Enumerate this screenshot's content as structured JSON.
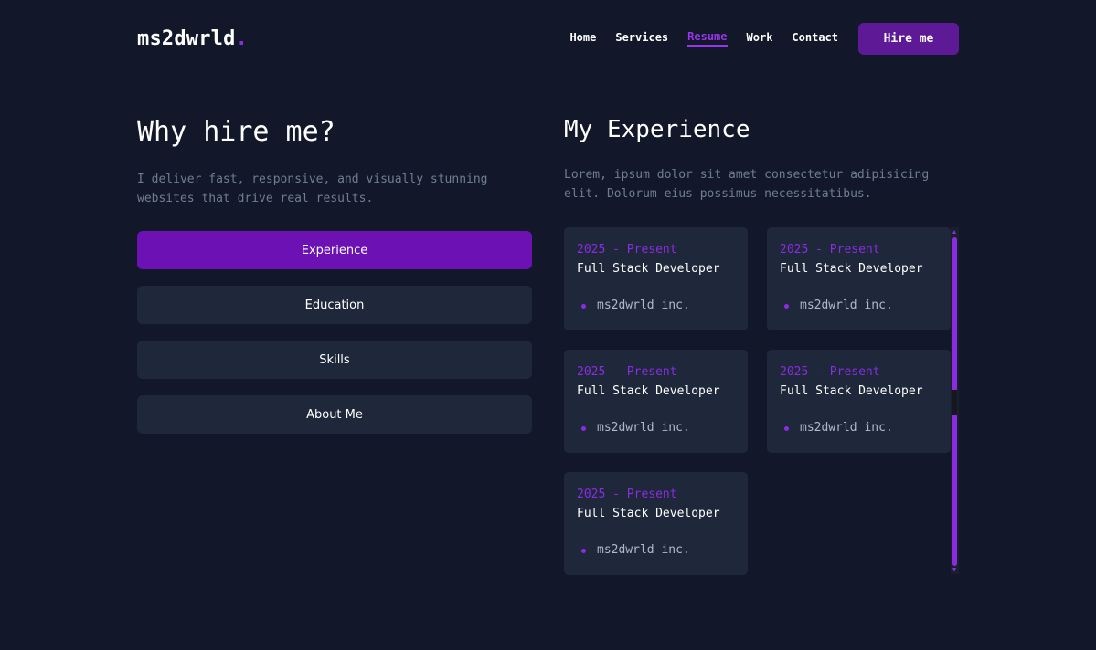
{
  "header": {
    "logo_text": "ms2dwrld",
    "logo_dot": ".",
    "nav": [
      {
        "label": "Home"
      },
      {
        "label": "Services"
      },
      {
        "label": "Resume"
      },
      {
        "label": "Work"
      },
      {
        "label": "Contact"
      }
    ],
    "active_nav": "Resume",
    "hire_label": "Hire me"
  },
  "left": {
    "title": "Why hire me?",
    "description": "I deliver fast, responsive, and visually stunning websites that drive real results.",
    "tabs": [
      {
        "label": "Experience"
      },
      {
        "label": "Education"
      },
      {
        "label": "Skills"
      },
      {
        "label": "About Me"
      }
    ],
    "active_tab": "Experience"
  },
  "right": {
    "title": "My Experience",
    "description": "Lorem, ipsum dolor sit amet consectetur adipisicing elit. Dolorum eius possimus necessitatibus.",
    "cards": [
      {
        "date": "2025 - Present",
        "role": "Full Stack Developer",
        "company": "ms2dwrld inc."
      },
      {
        "date": "2025 - Present",
        "role": "Full Stack Developer",
        "company": "ms2dwrld inc."
      },
      {
        "date": "2025 - Present",
        "role": "Full Stack Developer",
        "company": "ms2dwrld inc."
      },
      {
        "date": "2025 - Present",
        "role": "Full Stack Developer",
        "company": "ms2dwrld inc."
      },
      {
        "date": "2025 - Present",
        "role": "Full Stack Developer",
        "company": "ms2dwrld inc."
      }
    ]
  },
  "colors": {
    "background": "#121829",
    "accent": "#8b2be2",
    "card": "#1e283a",
    "active_tab": "#6c12b4",
    "hire_button": "#5e1a96",
    "muted_text": "#6f7d92"
  }
}
